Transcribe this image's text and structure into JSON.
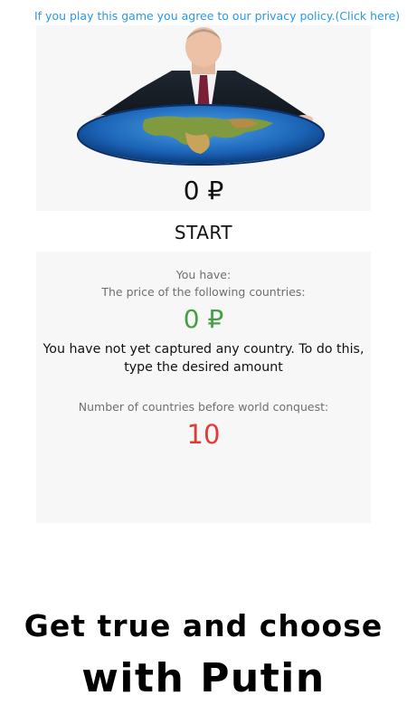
{
  "privacy": {
    "link_text": "If you play this game you agree to our privacy policy.(Click here)"
  },
  "hero": {
    "balance": "0 ₽"
  },
  "controls": {
    "start_label": "START"
  },
  "info": {
    "you_have_label": "You have:",
    "price_label": "The price of the following countries:",
    "price_value": "0 ₽",
    "capture_message": "You have not yet captured any country. To do this, type the desired amount",
    "conquest_label": "Number of countries before world conquest:",
    "countries_left": "10"
  },
  "promo": {
    "line1": "Get true and choose",
    "line2": "with Putin"
  },
  "colors": {
    "link": "#2a98e6",
    "price_green": "#43a047",
    "countries_red": "#e53935",
    "card_bg": "#f7f7f7"
  }
}
